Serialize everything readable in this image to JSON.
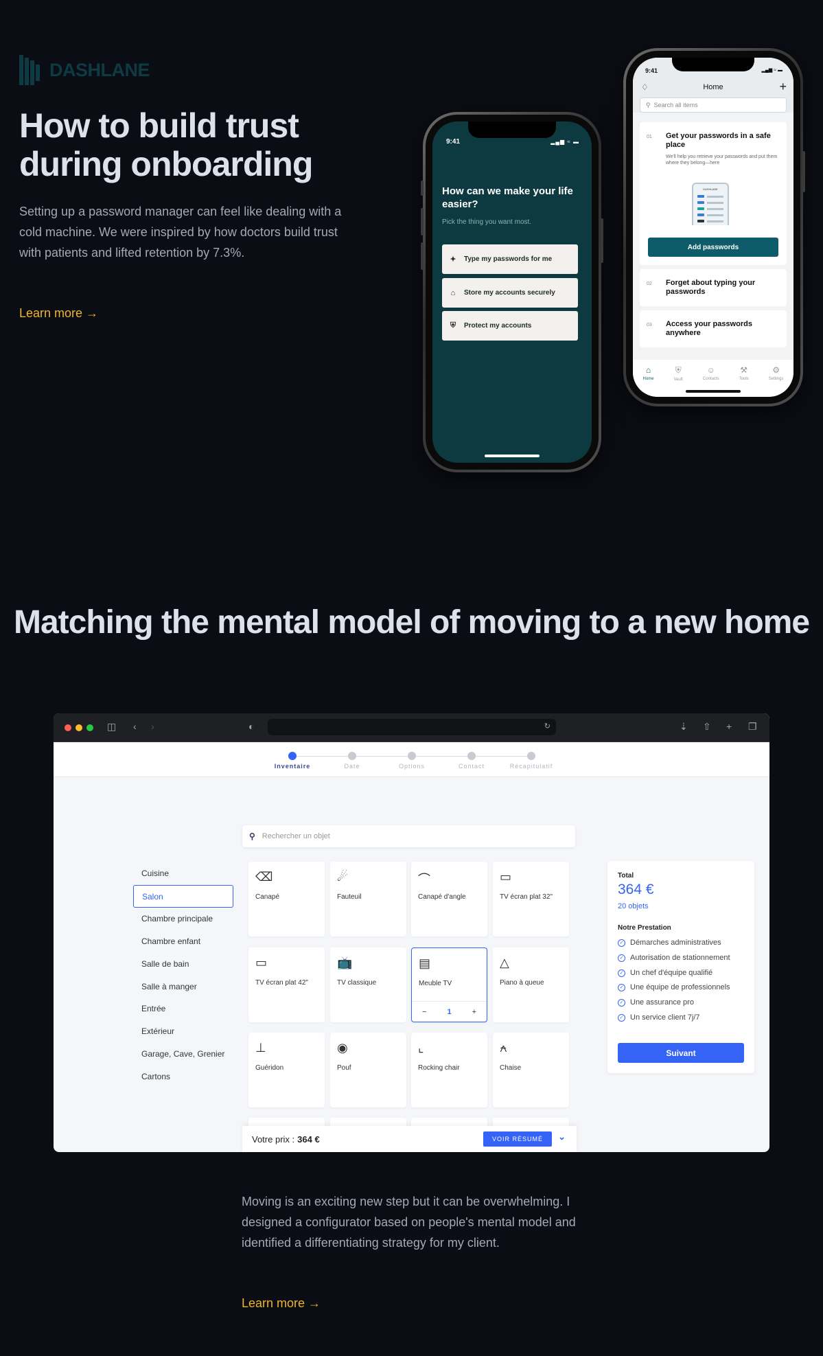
{
  "brand": {
    "name": "DASHLANE"
  },
  "section1": {
    "title": "How to build trust during onboarding",
    "description": "Setting up a password manager can feel like dealing with a cold machine. We were inspired by how doctors build trust with patients and lifted retention by 7.3%.",
    "learn_more": "Learn more →"
  },
  "phone1": {
    "time": "9:41",
    "question": "How can we make your life easier?",
    "subtitle": "Pick the thing you want most.",
    "options": [
      {
        "icon": "wand-icon",
        "label": "Type my passwords for me"
      },
      {
        "icon": "home-icon",
        "label": "Store my accounts securely"
      },
      {
        "icon": "shield-icon",
        "label": "Protect my accounts"
      }
    ]
  },
  "phone2": {
    "time": "9:41",
    "title": "Home",
    "search_placeholder": "Search all items",
    "cards": [
      {
        "num": "01",
        "title": "Get your passwords in a safe place",
        "desc": "We'll help you retrieve your passwords and put them where they belong—here"
      },
      {
        "num": "02",
        "title": "Forget about typing your passwords"
      },
      {
        "num": "03",
        "title": "Access your passwords anywhere"
      }
    ],
    "mini_label": "DASHLANE",
    "add_button": "Add passwords",
    "tabs": [
      "Home",
      "Vault",
      "Contacts",
      "Tools",
      "Settings"
    ]
  },
  "section2": {
    "title": "Matching the mental model of moving to a new home",
    "description": "Moving is an exciting new step but it can be overwhelming. I designed a configurator based on people's mental model and identified a differentiating strategy for my client.",
    "learn_more": "Learn more →"
  },
  "configurator": {
    "steps": [
      "Inventaire",
      "Date",
      "Options",
      "Contact",
      "Récapitulatif"
    ],
    "active_step": 0,
    "search_placeholder": "Rechercher un objet",
    "categories": [
      "Cuisine",
      "Salon",
      "Chambre principale",
      "Chambre enfant",
      "Salle de bain",
      "Salle à manger",
      "Entrée",
      "Extérieur",
      "Garage, Cave, Grenier",
      "Cartons"
    ],
    "active_category": "Salon",
    "items": [
      {
        "icon": "sofa-icon",
        "label": "Canapé"
      },
      {
        "icon": "armchair-icon",
        "label": "Fauteuil"
      },
      {
        "icon": "corner-sofa-icon",
        "label": "Canapé d'angle"
      },
      {
        "icon": "tv-icon",
        "label": "TV écran plat 32\""
      },
      {
        "icon": "tv-icon",
        "label": "TV écran plat 42\""
      },
      {
        "icon": "classic-tv-icon",
        "label": "TV classique"
      },
      {
        "icon": "tv-stand-icon",
        "label": "Meuble TV"
      },
      {
        "icon": "piano-icon",
        "label": "Piano à queue"
      },
      {
        "icon": "side-table-icon",
        "label": "Guéridon"
      },
      {
        "icon": "pouf-icon",
        "label": "Pouf"
      },
      {
        "icon": "rocking-chair-icon",
        "label": "Rocking chair"
      },
      {
        "icon": "chair-icon",
        "label": "Chaise"
      }
    ],
    "selected_qty": {
      "minus": "−",
      "value": "1",
      "plus": "+"
    },
    "summary": {
      "total_label": "Total",
      "price": "364 €",
      "count": "20 objets",
      "services_title": "Notre Prestation",
      "services": [
        "Démarches administratives",
        "Autorisation de stationnement",
        "Un chef d'équipe qualifié",
        "Une équipe de professionnels",
        "Une assurance pro",
        "Un service client 7j/7"
      ],
      "next_button": "Suivant"
    },
    "bottom": {
      "price_label": "Votre prix :",
      "price_value": "364 €",
      "button": "VOIR RÉSUMÉ"
    }
  }
}
